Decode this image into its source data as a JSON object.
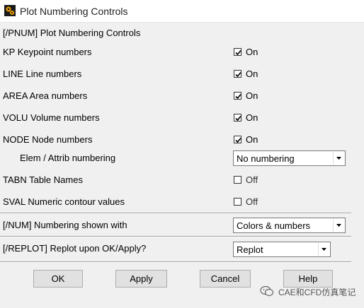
{
  "window": {
    "title": "Plot Numbering Controls",
    "icon": "ansys-gear-icon"
  },
  "header": {
    "text": "[/PNUM]  Plot Numbering Controls"
  },
  "rows": [
    {
      "key": "KP",
      "label": "KP     Keypoint numbers",
      "checked": true,
      "state": "On"
    },
    {
      "key": "LINE",
      "label": "LINE  Line numbers",
      "checked": true,
      "state": "On"
    },
    {
      "key": "AREA",
      "label": "AREA  Area numbers",
      "checked": true,
      "state": "On"
    },
    {
      "key": "VOLU",
      "label": "VOLU  Volume numbers",
      "checked": true,
      "state": "On"
    },
    {
      "key": "NODE",
      "label": "NODE  Node numbers",
      "checked": true,
      "state": "On"
    }
  ],
  "elem": {
    "label": "Elem / Attrib numbering",
    "value": "No numbering"
  },
  "rows_off": [
    {
      "key": "TABN",
      "label": "TABN  Table Names",
      "checked": false,
      "state": "Off"
    },
    {
      "key": "SVAL",
      "label": "SVAL  Numeric contour values",
      "checked": false,
      "state": "Off"
    }
  ],
  "num": {
    "label": "[/NUM]  Numbering shown with",
    "value": "Colors & numbers"
  },
  "replot": {
    "label": "[/REPLOT] Replot upon OK/Apply?",
    "value": "Replot"
  },
  "buttons": {
    "ok": "OK",
    "apply": "Apply",
    "cancel": "Cancel",
    "help": "Help"
  },
  "watermark": {
    "text": "CAE和CFD仿真笔记",
    "icon": "wechat-icon"
  },
  "colors": {
    "background": "#f0f0f0",
    "titlebar": "#ffffff",
    "button": "#e1e1e1"
  }
}
